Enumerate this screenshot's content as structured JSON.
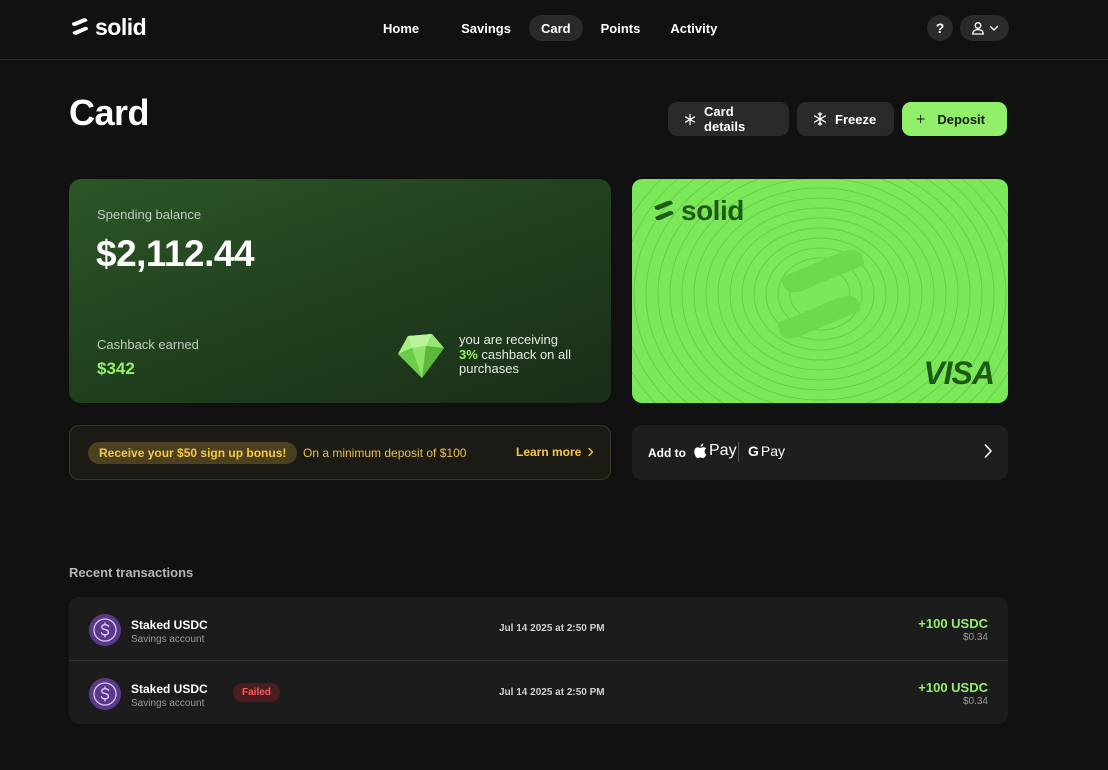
{
  "brand": {
    "name": "solid"
  },
  "nav": {
    "items": [
      {
        "label": "Home"
      },
      {
        "label": "Savings"
      },
      {
        "label": "Card",
        "active": true
      },
      {
        "label": "Points"
      },
      {
        "label": "Activity"
      }
    ],
    "help_label": "?"
  },
  "header": {
    "title": "Card",
    "card_details_label": "Card details",
    "freeze_label": "Freeze",
    "deposit_label": "Deposit"
  },
  "balance": {
    "label": "Spending balance",
    "value": "$2,112.44",
    "cashback_label": "Cashback earned",
    "cashback_value": "$342",
    "note_prefix": "you are receiving",
    "note_pct": "3%",
    "note_suffix": "cashback on all purchases"
  },
  "card": {
    "brand": "solid",
    "network": "VISA"
  },
  "bonus": {
    "pill": "Receive your $50 sign up bonus!",
    "text": "On a minimum deposit of $100",
    "link": "Learn more"
  },
  "wallet": {
    "label": "Add to",
    "apple_pay": "Pay",
    "google_pay": "Pay",
    "google_g": "G"
  },
  "transactions": {
    "title": "Recent transactions",
    "rows": [
      {
        "name": "Staked USDC",
        "account": "Savings account",
        "status": "",
        "date": "Jul 14 2025 at 2:50 PM",
        "amount": "+100 USDC",
        "fiat": "$0.34"
      },
      {
        "name": "Staked USDC",
        "account": "Savings account",
        "status": "Failed",
        "date": "Jul 14 2025 at 2:50 PM",
        "amount": "+100 USDC",
        "fiat": "$0.34"
      }
    ]
  },
  "colors": {
    "accent_green": "#92ef6c",
    "card_green": "#7be85a",
    "failed_red": "#ff5a5a",
    "bonus_yellow": "#f5c84a"
  },
  "icons": {
    "logo": "solid-logo-icon",
    "user": "user-icon",
    "chevron_down": "chevron-down-icon",
    "asterisk": "asterisk-icon",
    "snowflake": "snowflake-icon",
    "plus": "plus-icon",
    "gem": "gem-icon",
    "chevron_right": "chevron-right-icon",
    "apple": "apple-icon",
    "usdc": "usdc-icon"
  }
}
